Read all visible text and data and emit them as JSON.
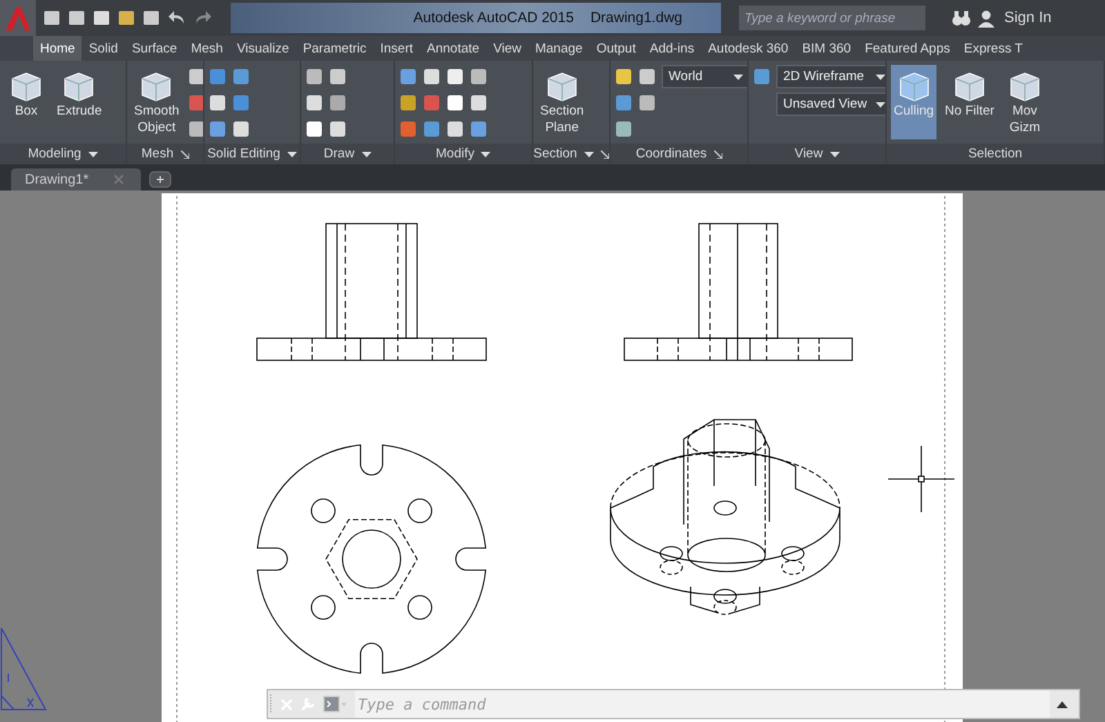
{
  "title_bar": {
    "app_title": "Autodesk AutoCAD 2015",
    "file_name": "Drawing1.dwg",
    "search": {
      "placeholder": "Type a keyword or phrase"
    },
    "sign_in": "Sign In"
  },
  "ribbon_tabs": [
    {
      "label": "Home",
      "selected": true
    },
    {
      "label": "Solid",
      "selected": false
    },
    {
      "label": "Surface",
      "selected": false
    },
    {
      "label": "Mesh",
      "selected": false
    },
    {
      "label": "Visualize",
      "selected": false
    },
    {
      "label": "Parametric",
      "selected": false
    },
    {
      "label": "Insert",
      "selected": false
    },
    {
      "label": "Annotate",
      "selected": false
    },
    {
      "label": "View",
      "selected": false
    },
    {
      "label": "Manage",
      "selected": false
    },
    {
      "label": "Output",
      "selected": false
    },
    {
      "label": "Add-ins",
      "selected": false
    },
    {
      "label": "Autodesk 360",
      "selected": false
    },
    {
      "label": "BIM 360",
      "selected": false
    },
    {
      "label": "Featured Apps",
      "selected": false
    },
    {
      "label": "Express T",
      "selected": false
    }
  ],
  "panels": [
    {
      "title": "Modeling",
      "dropdown": true,
      "launcher": false,
      "large_buttons": [
        {
          "lines": [
            "Box"
          ],
          "selected": false
        },
        {
          "lines": [
            "Extrude"
          ],
          "selected": false
        }
      ]
    },
    {
      "title": "Mesh",
      "dropdown": false,
      "launcher": true,
      "large_buttons": [
        {
          "lines": [
            "Smooth",
            "Object"
          ],
          "selected": false
        }
      ]
    },
    {
      "title": "Solid Editing",
      "dropdown": true,
      "launcher": false
    },
    {
      "title": "Draw",
      "dropdown": true,
      "launcher": false
    },
    {
      "title": "Modify",
      "dropdown": true,
      "launcher": false
    },
    {
      "title": "Section",
      "dropdown": true,
      "launcher": true,
      "large_buttons": [
        {
          "lines": [
            "Section",
            "Plane"
          ],
          "selected": false
        }
      ]
    },
    {
      "title": "Coordinates",
      "dropdown": false,
      "launcher": true,
      "dropdowns": [
        {
          "value": "World"
        }
      ]
    },
    {
      "title": "View",
      "dropdown": true,
      "launcher": false,
      "dropdowns": [
        {
          "value": "2D Wireframe"
        },
        {
          "value": "Unsaved View"
        }
      ]
    },
    {
      "title": "Selection",
      "dropdown": false,
      "launcher": false,
      "large_buttons": [
        {
          "lines": [
            "Culling"
          ],
          "selected": true
        },
        {
          "lines": [
            "No Filter"
          ],
          "selected": false
        },
        {
          "lines": [
            "Mov",
            "Gizm"
          ],
          "selected": false
        }
      ]
    }
  ],
  "document_tabs": [
    {
      "label": "Drawing1*",
      "selected": true
    }
  ],
  "command_line": {
    "placeholder": "Type a command"
  }
}
